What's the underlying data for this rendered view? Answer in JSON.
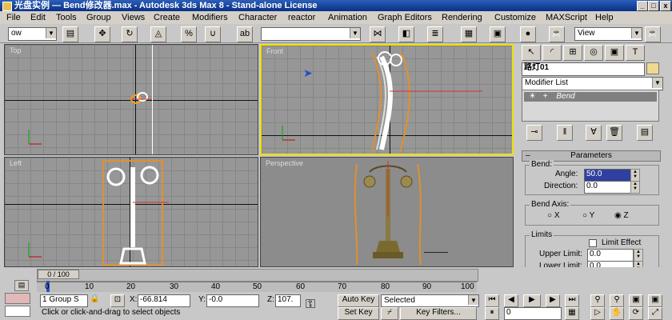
{
  "window": {
    "title": "光盘实例 — Bend修改器.max - Autodesk 3ds Max 8 - Stand-alone License"
  },
  "menu": [
    "File",
    "Edit",
    "Tools",
    "Group",
    "Views",
    "Create",
    "Modifiers",
    "Character",
    "reactor",
    "Animation",
    "Graph Editors",
    "Rendering",
    "Customize",
    "MAXScript",
    "Help"
  ],
  "toolbar": {
    "selection_filter": "ow",
    "named_selection": "",
    "view_dropdown": "View"
  },
  "viewports": {
    "top": {
      "label": "Top"
    },
    "front": {
      "label": "Front"
    },
    "left": {
      "label": "Left"
    },
    "perspective": {
      "label": "Perspective"
    }
  },
  "command_panel": {
    "object_name": "路灯01",
    "modifier_list": "Modifier List",
    "stack_item": "Bend",
    "parameters": {
      "title": "Parameters",
      "bend_group": "Bend:",
      "angle_label": "Angle:",
      "angle_value": "50.0",
      "direction_label": "Direction:",
      "direction_value": "0.0",
      "bend_axis_group": "Bend Axis:",
      "axis_x": "X",
      "axis_y": "Y",
      "axis_z": "Z",
      "selected_axis": "Z",
      "limits_group": "Limits",
      "limit_effect": "Limit Effect",
      "upper_label": "Upper Limit:",
      "upper_value": "0.0",
      "lower_label": "Lower Limit:",
      "lower_value": "0.0"
    }
  },
  "timeline": {
    "frame_display": "0 / 100",
    "ticks": [
      "0",
      "10",
      "20",
      "30",
      "40",
      "50",
      "60",
      "70",
      "80",
      "90",
      "100"
    ]
  },
  "status": {
    "selection": "1 Group S",
    "x_label": "X:",
    "x_value": "-66.814",
    "y_label": "Y:",
    "y_value": "-0.0",
    "z_label": "Z:",
    "z_value": "107.",
    "prompt": "Click or click-and-drag to select objects",
    "auto_key": "Auto Key",
    "set_key": "Set Key",
    "key_mode": "Selected",
    "key_filters": "Key Filters...",
    "current_frame": "0"
  }
}
